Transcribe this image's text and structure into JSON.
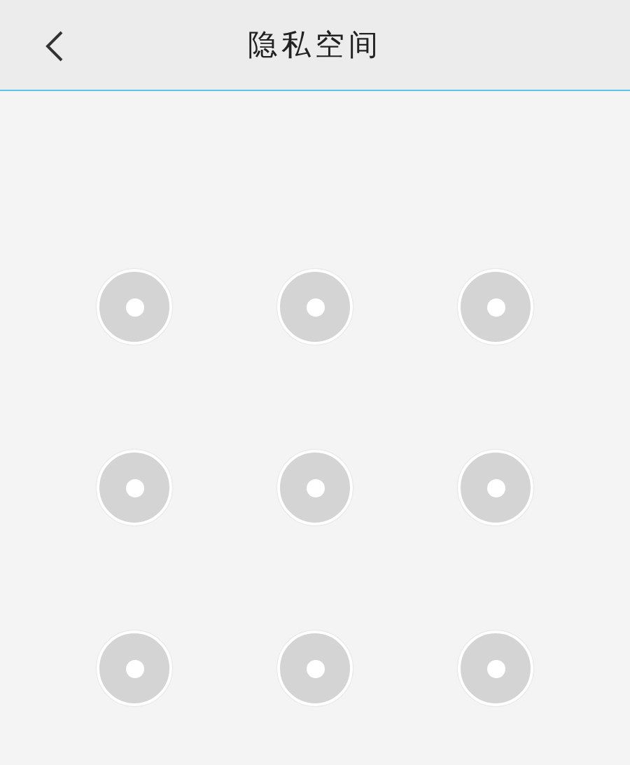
{
  "header": {
    "title": "隐私空间"
  },
  "pattern_nodes": [
    {
      "selected": false
    },
    {
      "selected": false
    },
    {
      "selected": false
    },
    {
      "selected": false
    },
    {
      "selected": false
    },
    {
      "selected": false
    },
    {
      "selected": false
    },
    {
      "selected": false
    },
    {
      "selected": false
    }
  ]
}
